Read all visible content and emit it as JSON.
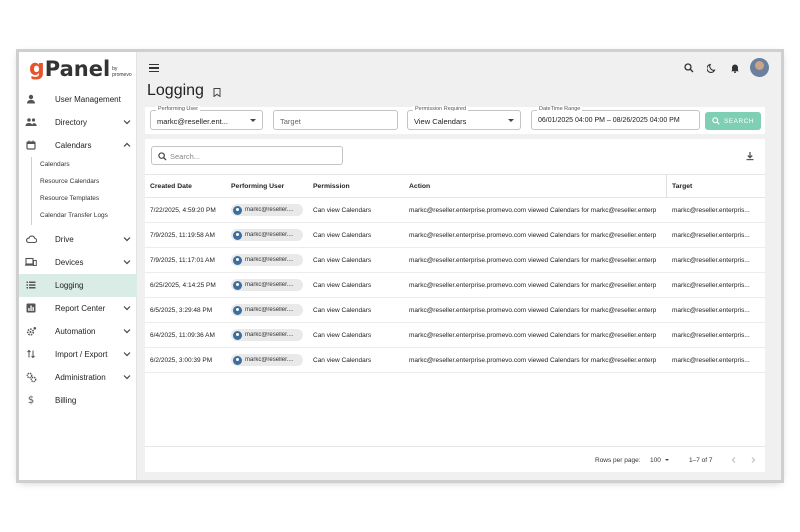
{
  "brand": {
    "logo_g": "g",
    "logo_panel": "Panel",
    "logo_by": "by",
    "logo_vendor": "promevo"
  },
  "colors": {
    "accent": "#7fcfb4",
    "active_bg": "#d9ece6",
    "logo_orange": "#e8532c"
  },
  "sidebar": {
    "items": [
      {
        "label": "User Management",
        "icon": "person-icon"
      },
      {
        "label": "Directory",
        "icon": "people-icon"
      },
      {
        "label": "Calendars",
        "icon": "calendar-icon"
      },
      {
        "label": "Drive",
        "icon": "drive-icon"
      },
      {
        "label": "Devices",
        "icon": "devices-icon"
      },
      {
        "label": "Logging",
        "icon": "list-icon"
      },
      {
        "label": "Report Center",
        "icon": "report-icon"
      },
      {
        "label": "Automation",
        "icon": "gear-icon"
      },
      {
        "label": "Import / Export",
        "icon": "import-export-icon"
      },
      {
        "label": "Administration",
        "icon": "admin-icon"
      },
      {
        "label": "Billing",
        "icon": "dollar-icon"
      }
    ],
    "calendar_sub": [
      "Calendars",
      "Resource Calendars",
      "Resource Templates",
      "Calendar Transfer Logs"
    ]
  },
  "page": {
    "title": "Logging"
  },
  "filters": {
    "performing_user": {
      "label": "Performing User",
      "value": "markc@reseller.ent..."
    },
    "target": {
      "placeholder": "Target"
    },
    "permission": {
      "label": "Permission Required",
      "value": "View Calendars"
    },
    "date_range": {
      "label": "DateTime Range",
      "value": "06/01/2025 04:00 PM – 08/26/2025 04:00 PM"
    },
    "search_button": "SEARCH"
  },
  "table": {
    "search_placeholder": "Search...",
    "columns": [
      "Created Date",
      "Performing User",
      "Permission",
      "Action",
      "Target"
    ],
    "rows": [
      {
        "date": "7/22/2025, 4:59:20 PM",
        "user": "markc@reseller....",
        "permission": "Can view Calendars",
        "action": "markc@reseller.enterprise.promevo.com viewed Calendars for markc@reseller.enterp",
        "target": "markc@reseller.enterpris..."
      },
      {
        "date": "7/9/2025, 11:19:58 AM",
        "user": "markc@reseller....",
        "permission": "Can view Calendars",
        "action": "markc@reseller.enterprise.promevo.com viewed Calendars for markc@reseller.enterp",
        "target": "markc@reseller.enterpris..."
      },
      {
        "date": "7/9/2025, 11:17:01 AM",
        "user": "markc@reseller....",
        "permission": "Can view Calendars",
        "action": "markc@reseller.enterprise.promevo.com viewed Calendars for markc@reseller.enterp",
        "target": "markc@reseller.enterpris..."
      },
      {
        "date": "6/25/2025, 4:14:25 PM",
        "user": "markc@reseller....",
        "permission": "Can view Calendars",
        "action": "markc@reseller.enterprise.promevo.com viewed Calendars for markc@reseller.enterp",
        "target": "markc@reseller.enterpris..."
      },
      {
        "date": "6/5/2025, 3:29:48 PM",
        "user": "markc@reseller....",
        "permission": "Can view Calendars",
        "action": "markc@reseller.enterprise.promevo.com viewed Calendars for markc@reseller.enterp",
        "target": "markc@reseller.enterpris..."
      },
      {
        "date": "6/4/2025, 11:09:36 AM",
        "user": "markc@reseller....",
        "permission": "Can view Calendars",
        "action": "markc@reseller.enterprise.promevo.com viewed Calendars for markc@reseller.enterp",
        "target": "markc@reseller.enterpris..."
      },
      {
        "date": "6/2/2025, 3:00:39 PM",
        "user": "markc@reseller....",
        "permission": "Can view Calendars",
        "action": "markc@reseller.enterprise.promevo.com viewed Calendars for markc@reseller.enterp",
        "target": "markc@reseller.enterpris..."
      }
    ],
    "footer": {
      "rows_per_page_label": "Rows per page:",
      "rows_per_page": "100",
      "range": "1–7 of 7"
    }
  }
}
